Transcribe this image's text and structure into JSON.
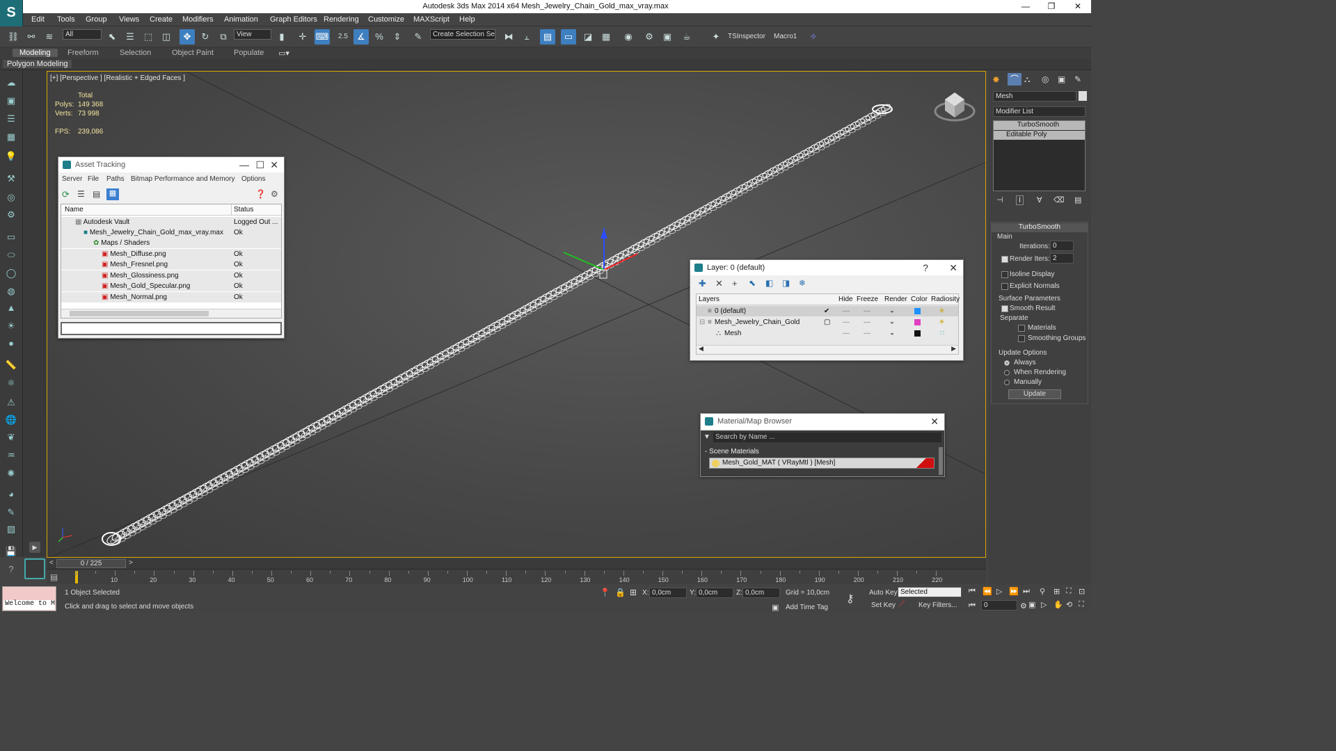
{
  "app": {
    "title": "Autodesk 3ds Max  2014 x64    Mesh_Jewelry_Chain_Gold_max_vray.max"
  },
  "window_controls": {
    "minimize": "—",
    "restore": "❐",
    "close": "✕"
  },
  "menu": [
    "Edit",
    "Tools",
    "Group",
    "Views",
    "Create",
    "Modifiers",
    "Animation",
    "Graph Editors",
    "Rendering",
    "Customize",
    "MAXScript",
    "Help"
  ],
  "toolbar": {
    "selection_filter": "All",
    "ref_coord": "View",
    "snap_value": "2.5",
    "named_selection": "Create Selection Se",
    "tsinspector": "TSInspector",
    "macro": "Macro1"
  },
  "ribbon": {
    "tabs": [
      "Modeling",
      "Freeform",
      "Selection",
      "Object Paint",
      "Populate"
    ],
    "active": "Modeling",
    "subtab": "Polygon Modeling"
  },
  "viewport": {
    "label": "[+] [Perspective ] [Realistic + Edged Faces ]",
    "stats": {
      "total_label": "Total",
      "polys_label": "Polys:",
      "polys": "149 368",
      "verts_label": "Verts:",
      "verts": "73 998",
      "fps_label": "FPS:",
      "fps": "239,086"
    }
  },
  "asset_tracking": {
    "title": "Asset Tracking",
    "menu": [
      "Server",
      "File",
      "Paths",
      "Bitmap Performance and Memory",
      "Options"
    ],
    "columns": [
      "Name",
      "Status"
    ],
    "rows": [
      {
        "name": "Autodesk Vault",
        "status": "Logged Out ..."
      },
      {
        "name": "Mesh_Jewelry_Chain_Gold_max_vray.max",
        "status": "Ok"
      },
      {
        "name": "Maps / Shaders",
        "status": ""
      },
      {
        "name": "Mesh_Diffuse.png",
        "status": "Ok"
      },
      {
        "name": "Mesh_Fresnel.png",
        "status": "Ok"
      },
      {
        "name": "Mesh_Glossiness.png",
        "status": "Ok"
      },
      {
        "name": "Mesh_Gold_Specular.png",
        "status": "Ok"
      },
      {
        "name": "Mesh_Normal.png",
        "status": "Ok"
      }
    ]
  },
  "layers": {
    "title": "Layer: 0 (default)",
    "help": "?",
    "columns": [
      "Layers",
      "Hide",
      "Freeze",
      "Render",
      "Color",
      "Radiosity"
    ],
    "rows": [
      {
        "name": "0 (default)",
        "color": "#1e90ff"
      },
      {
        "name": "Mesh_Jewelry_Chain_Gold",
        "color": "#e040c0"
      },
      {
        "name": "Mesh",
        "color": "#111111"
      }
    ]
  },
  "material_browser": {
    "title": "Material/Map Browser",
    "search_placeholder": "Search by Name ...",
    "section": "- Scene Materials",
    "item": "Mesh_Gold_MAT  ( VRayMtl )  [Mesh]"
  },
  "command_panel": {
    "object_name": "Mesh",
    "modifier_list": "Modifier List",
    "stack": [
      "TurboSmooth",
      "Editable Poly"
    ],
    "rollout": "TurboSmooth",
    "main": "Main",
    "iterations_label": "Iterations:",
    "iterations": "0",
    "render_iters_label": "Render Iters:",
    "render_iters": "2",
    "isoline": "Isoline Display",
    "explicit": "Explicit Normals",
    "surface": "Surface Parameters",
    "smooth_result": "Smooth Result",
    "separate": "Separate",
    "materials": "Materials",
    "smoothing_groups": "Smoothing Groups",
    "update_options": "Update Options",
    "always": "Always",
    "when_rendering": "When Rendering",
    "manually": "Manually",
    "update": "Update"
  },
  "timeline": {
    "frame": "0 / 225",
    "ticks": [
      "10",
      "20",
      "30",
      "40",
      "50",
      "60",
      "70",
      "80",
      "90",
      "100",
      "110",
      "120",
      "130",
      "140",
      "150",
      "160",
      "170",
      "180",
      "190",
      "200",
      "210",
      "220"
    ]
  },
  "status": {
    "welcome": "Welcome to M",
    "selected": "1 Object Selected",
    "hint": "Click and drag to select and move objects",
    "x_label": "X:",
    "x": "0,0cm",
    "y_label": "Y:",
    "y": "0,0cm",
    "z_label": "Z:",
    "z": "0,0cm",
    "grid": "Grid = 10,0cm",
    "add_time_tag": "Add Time Tag",
    "auto_key": "Auto Key",
    "set_key": "Set Key",
    "key_mode": "Selected",
    "key_filters": "Key Filters...",
    "frame_field": "0"
  }
}
